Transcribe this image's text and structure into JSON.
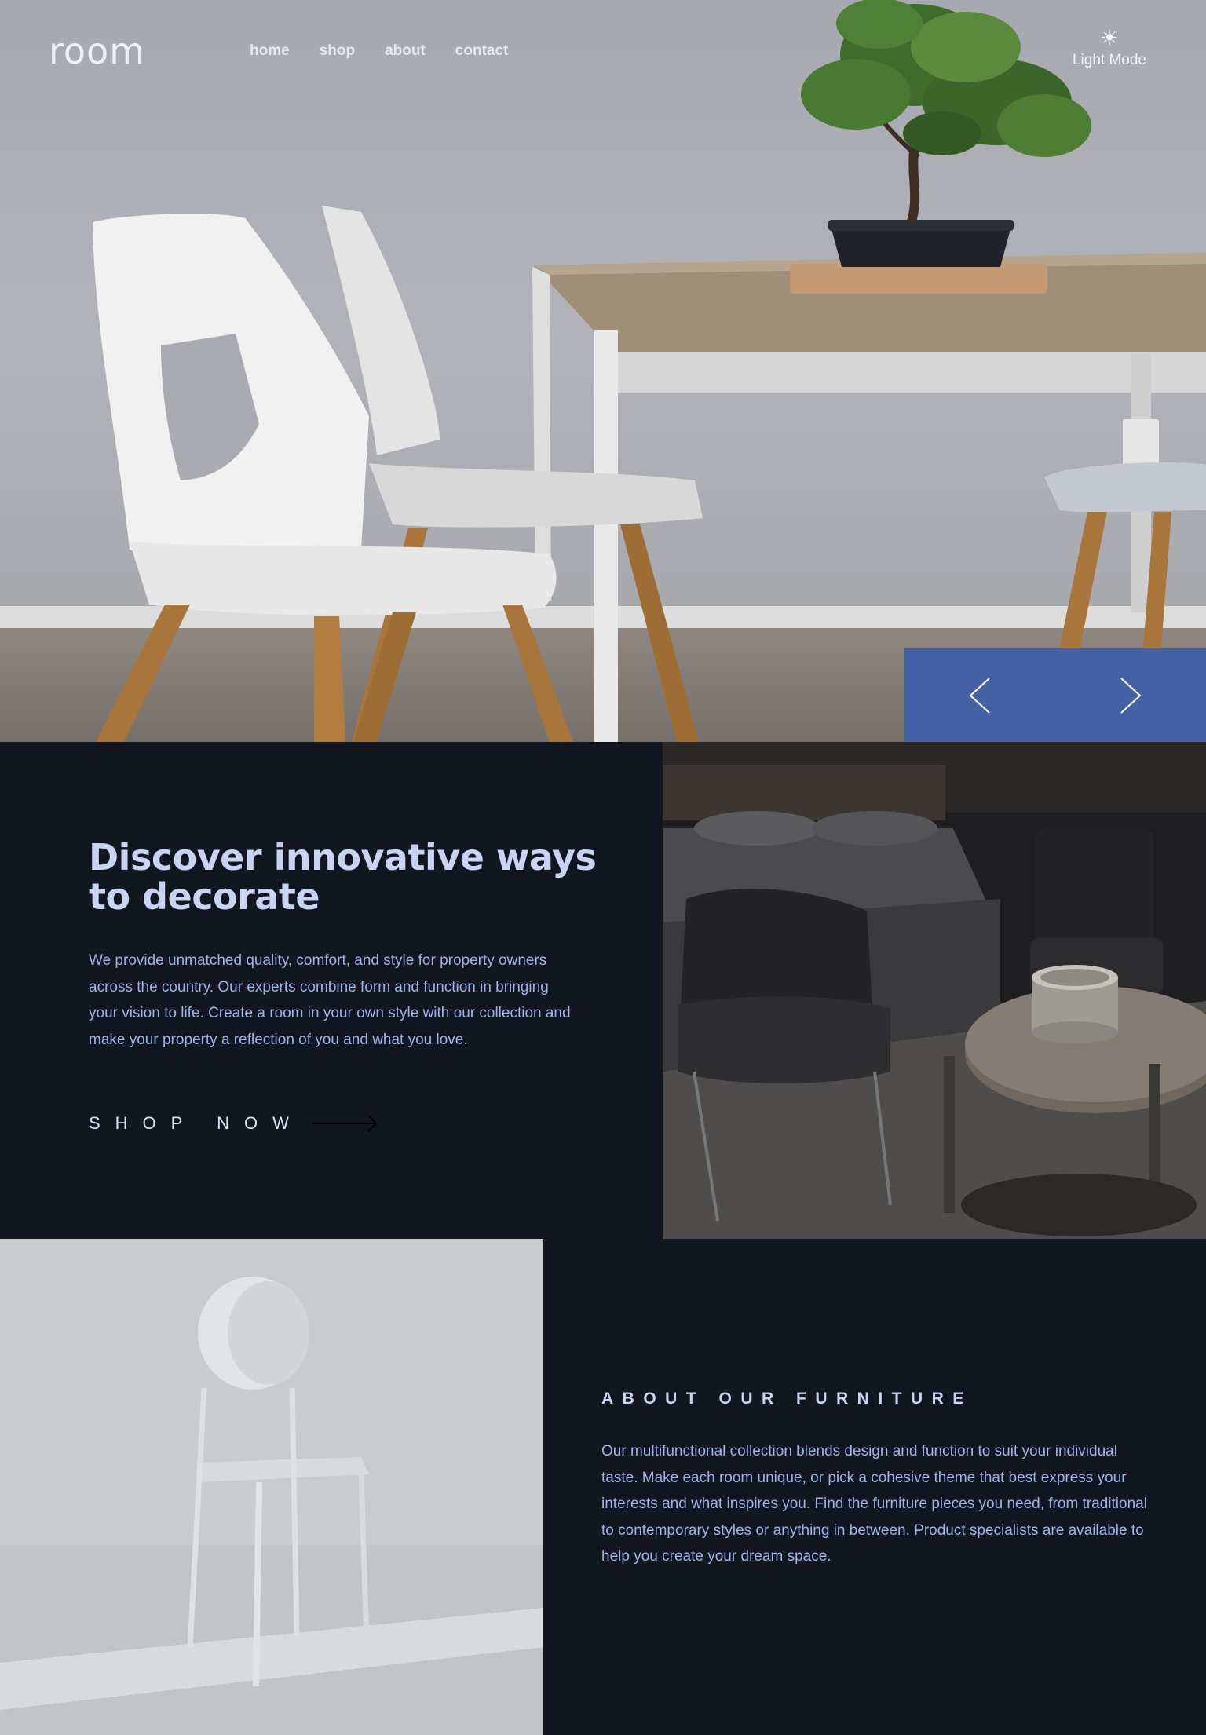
{
  "brand": {
    "logo": "room"
  },
  "nav": {
    "items": [
      {
        "label": "home"
      },
      {
        "label": "shop"
      },
      {
        "label": "about"
      },
      {
        "label": "contact"
      }
    ]
  },
  "theme_toggle": {
    "icon": "sun-icon",
    "label": "Light Mode"
  },
  "hero": {
    "image": "dining-chairs-and-table-with-bonsai",
    "controls": {
      "prev_icon": "chevron-left-icon",
      "next_icon": "chevron-right-icon"
    }
  },
  "discover": {
    "title": "Discover innovative ways to decorate",
    "body": "We provide unmatched quality, comfort, and style for property owners across the country. Our experts combine form and function in bringing your vision to life. Create a room in your own style with our collection and make your property a reflection of you and what you love.",
    "cta": "SHOP NOW",
    "cta_icon": "arrow-right-icon",
    "image": "dark-lounge-chairs-and-coffee-table"
  },
  "about": {
    "image": "white-chair-against-light-wall",
    "title": "ABOUT OUR FURNITURE",
    "body": "Our multifunctional collection blends design and function to suit your individual taste. Make each room unique, or pick a cohesive theme that best express your interests and what inspires you. Find the furniture pieces you need, from traditional to contemporary styles or anything in between. Product specialists are available to help you create your dream space."
  },
  "colors": {
    "background": "#121621",
    "accent": "#4462a5",
    "heading": "#c8d4f1",
    "body_text": "#9db3e6"
  }
}
